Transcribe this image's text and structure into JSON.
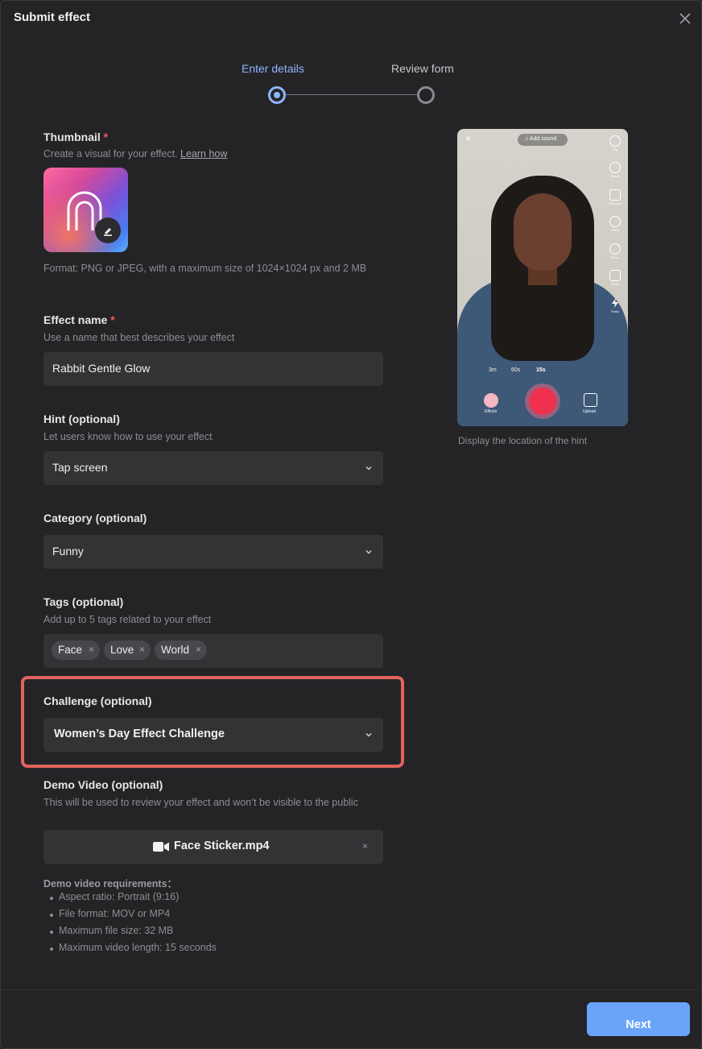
{
  "dialog": {
    "title": "Submit effect"
  },
  "stepper": {
    "steps": [
      "Enter details",
      "Review form"
    ],
    "active_index": 0
  },
  "thumbnail": {
    "label": "Thumbnail",
    "required_mark": "*",
    "help": "Create a visual for your effect.",
    "learn_more": "Learn how",
    "format_note": "Format: PNG or JPEG, with a maximum size of 1024×1024 px and 2 MB"
  },
  "effect_name": {
    "label": "Effect name",
    "required_mark": "*",
    "help": "Use a name that best describes your effect",
    "value": "Rabbit Gentle Glow"
  },
  "hint": {
    "label": "Hint (optional)",
    "help": "Let users know how to use your effect",
    "value": "Tap screen"
  },
  "category": {
    "label": "Category (optional)",
    "value": "Funny"
  },
  "tags": {
    "label": "Tags (optional)",
    "help": "Add up to 5 tags related to your effect",
    "items": [
      "Face",
      "Love",
      "World"
    ],
    "remove_glyph": "×"
  },
  "challenge": {
    "label": "Challenge (optional)",
    "value": "Women’s Day Effect Challenge"
  },
  "demo_video": {
    "label": "Demo Video (optional)",
    "help": "This will be used to review your effect and won’t be visible to the public",
    "file_name": "Face Sticker.mp4",
    "remove_glyph": "×",
    "requirements_title": "Demo video requirements：",
    "requirements": [
      "Aspect ratio: Portrait (9:16)",
      "File format: MOV or MP4",
      "Maximum file size: 32 MB",
      "Maximum video length: 15 seconds"
    ]
  },
  "preview": {
    "add_sound": "♫ Add sound",
    "close_glyph": "✕",
    "side_tools": [
      "Flip",
      "Speed",
      "Retouch",
      "Filters",
      "Timer",
      "Photo",
      "Flash"
    ],
    "durations": [
      "3m",
      "60s",
      "15s"
    ],
    "effects_label": "Effects",
    "upload_label": "Upload",
    "caption": "Display the location of the hint"
  },
  "footer": {
    "next_label": "Next"
  },
  "colors": {
    "accent": "#8fb4ff",
    "primary_button": "#6aa4f8",
    "highlight": "#e0645c",
    "record": "#f0304f"
  }
}
